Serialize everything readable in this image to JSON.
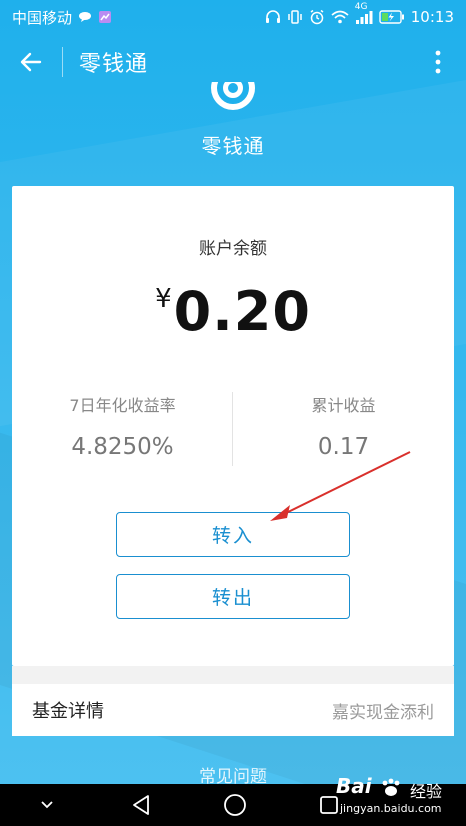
{
  "status_bar": {
    "carrier": "中国移动",
    "network": "4G",
    "time": "10:13"
  },
  "app_bar": {
    "title": "零钱通"
  },
  "header": {
    "product_name": "零钱通"
  },
  "account": {
    "label": "账户余额",
    "currency": "¥",
    "balance": "0.20"
  },
  "stats": {
    "yield_label": "7日年化收益率",
    "yield_value": "4.8250%",
    "earnings_label": "累计收益",
    "earnings_value": "0.17"
  },
  "buttons": {
    "transfer_in": "转入",
    "transfer_out": "转出"
  },
  "fund": {
    "label": "基金详情",
    "value": "嘉实现金添利"
  },
  "faq": {
    "label": "常见问题"
  },
  "watermark": {
    "brand_a": "Bai",
    "brand_b": "经验",
    "url": "jingyan.baidu.com"
  },
  "colors": {
    "bg": "#1fb0ec",
    "accent": "#1a8fd0",
    "arrow": "#d9302c"
  }
}
